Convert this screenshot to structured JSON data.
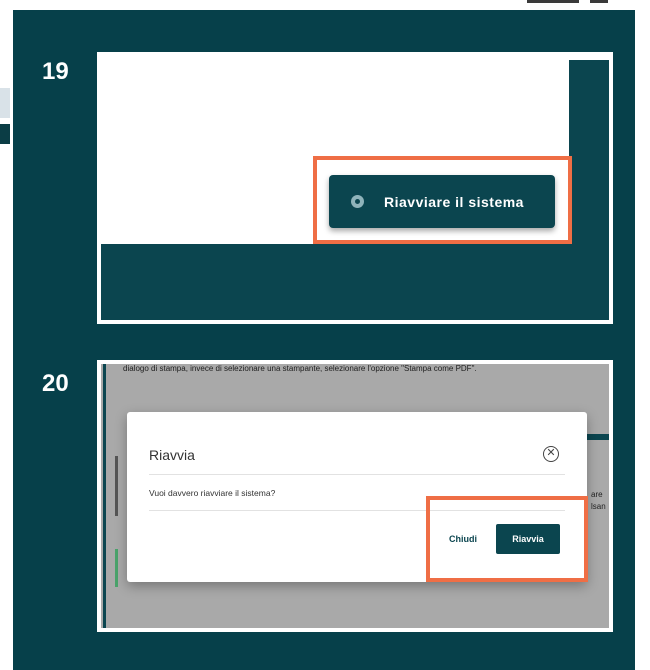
{
  "step1": {
    "number": "19",
    "restart_button_label": "Riavviare il sistema",
    "restart_icon": "restart-icon"
  },
  "step2": {
    "number": "20",
    "background_text": "dialogo di stampa, invece di selezionare una stampante, selezionare l'opzione \"Stampa come PDF\".",
    "background_side_text": [
      "are",
      "lsan"
    ],
    "modal": {
      "title": "Riavvia",
      "close_icon": "close-circle-icon",
      "question": "Vuoi davvero riavviare il sistema?",
      "cancel_label": "Chiudi",
      "confirm_label": "Riavvia"
    }
  },
  "colors": {
    "panel_background": "#06404a",
    "highlight": "#ef6e45",
    "button": "#0b454f"
  }
}
